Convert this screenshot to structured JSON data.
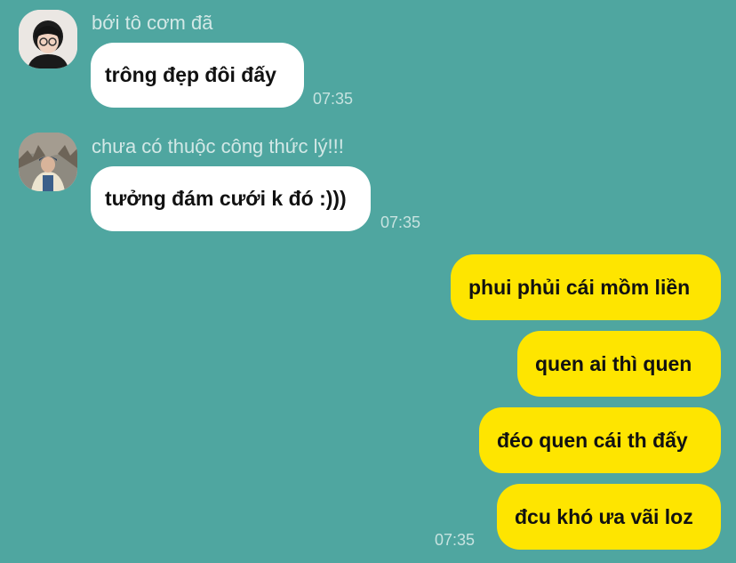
{
  "messages_incoming": [
    {
      "sender": "bới tô cơm đã",
      "avatar": "avatar-person-glasses",
      "text": "trông đẹp đôi đấy",
      "time": "07:35"
    },
    {
      "sender": "chưa có thuộc công thức lý!!!",
      "avatar": "avatar-person-outdoor",
      "text": "tưởng đám cưới k đó :)))",
      "time": "07:35"
    }
  ],
  "messages_outgoing": [
    {
      "text": "phui phủi cái mồm liền"
    },
    {
      "text": "quen ai thì quen"
    },
    {
      "text": "đéo quen cái th đấy"
    },
    {
      "text": "đcu khó ưa vãi loz"
    }
  ],
  "outgoing_time": "07:35",
  "colors": {
    "background": "#4fa6a0",
    "incoming_bubble": "#ffffff",
    "outgoing_bubble": "#fee500"
  }
}
